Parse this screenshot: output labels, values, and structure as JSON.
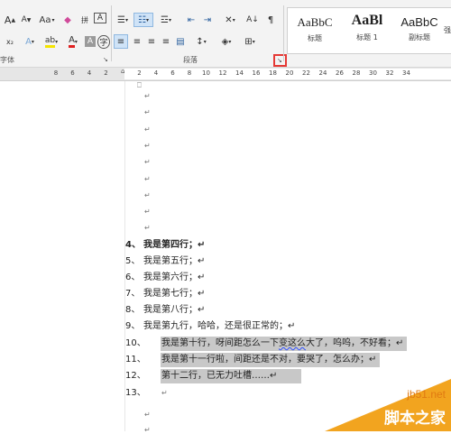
{
  "ribbon": {
    "font_group_label": "字体",
    "paragraph_group_label": "段落",
    "font": {
      "grow_label": "A",
      "shrink_label": "A",
      "change_case_label": "Aa",
      "phonetic_label": "拼",
      "char_border_label": "A",
      "text_effect_label": "A",
      "highlight_label": "ab",
      "font_color_label": "A",
      "char_shade_label": "A",
      "enclose_label": "字"
    },
    "styles": [
      {
        "sample": "AaBbC",
        "name": "标题"
      },
      {
        "sample": "AaBl",
        "name": "标题 1"
      },
      {
        "sample": "AaBbC",
        "name": "副标题"
      },
      {
        "sample": "",
        "name": "强"
      }
    ],
    "colors": {
      "highlight_yellow": "#f4e400",
      "font_red": "#e02020",
      "launcher_highlight": "#e53935"
    }
  },
  "ruler": {
    "ticks_left": [
      "8",
      "6",
      "4",
      "2"
    ],
    "ticks_right": [
      "2",
      "4",
      "6",
      "8",
      "10",
      "12",
      "14",
      "16",
      "18",
      "20",
      "22",
      "24",
      "26",
      "28",
      "30",
      "32",
      "34"
    ]
  },
  "document": {
    "para_mark": "↵",
    "lines": [
      {
        "num": "4、",
        "text": "我是第四行；↵",
        "bold": true
      },
      {
        "num": "5、",
        "text": "我是第五行；↵"
      },
      {
        "num": "6、",
        "text": "我是第六行；↵"
      },
      {
        "num": "7、",
        "text": "我是第七行；↵"
      },
      {
        "num": "8、",
        "text": "我是第八行；↵"
      },
      {
        "num": "9、",
        "text": "我是第九行，哈哈，还是很正常的；↵"
      },
      {
        "num": "10、",
        "text_a": "我是第十行，呀间距怎么一下",
        "text_wavy": "变这么",
        "text_b": "大了，呜呜，不好看；↵"
      },
      {
        "num": "11、",
        "text": "我是第十一行啦，间距还是不对，要哭了，怎么办；↵"
      },
      {
        "num": "12、",
        "text": "第十二行，已无力吐槽……↵"
      },
      {
        "num": "13、",
        "text": "↵"
      }
    ]
  },
  "watermark": {
    "domain": "jb51.net",
    "site_name": "脚本之家"
  }
}
